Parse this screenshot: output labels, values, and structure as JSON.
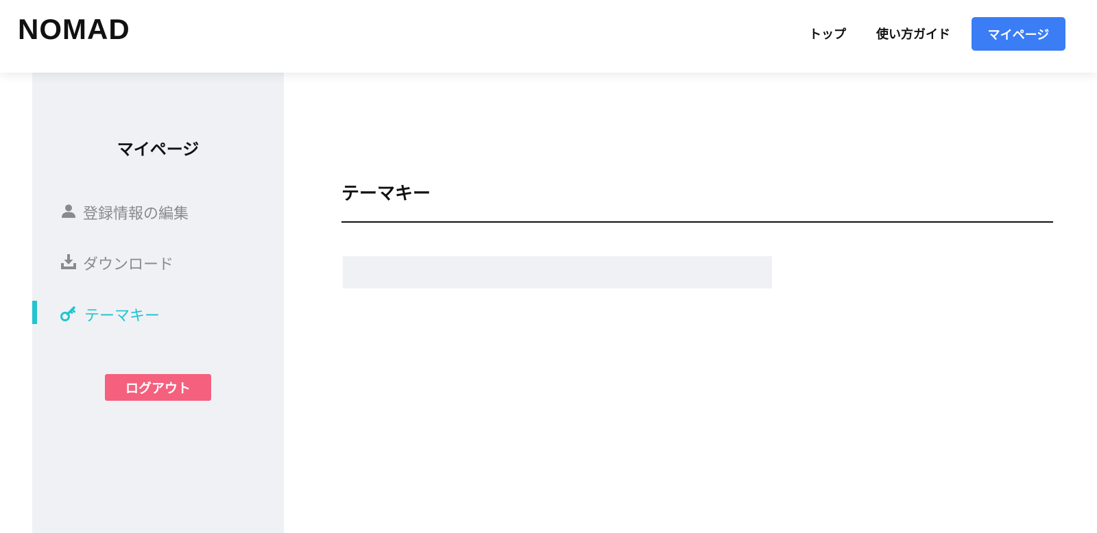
{
  "header": {
    "logo": "NOMAD",
    "nav": {
      "top": "トップ",
      "guide": "使い方ガイド",
      "mypage": "マイページ"
    }
  },
  "sidebar": {
    "title": "マイページ",
    "items": [
      {
        "label": "登録情報の編集",
        "icon": "user-icon"
      },
      {
        "label": "ダウンロード",
        "icon": "download-icon"
      },
      {
        "label": "テーマキー",
        "icon": "key-icon",
        "active": true
      }
    ],
    "logout": "ログアウト"
  },
  "main": {
    "title": "テーマキー",
    "key_value": ""
  },
  "colors": {
    "accent": "#3a7df5",
    "active": "#22c4cf",
    "logout": "#f5607f",
    "sidebar_bg": "#f0f1f5",
    "muted_text": "#8a8a8a"
  }
}
